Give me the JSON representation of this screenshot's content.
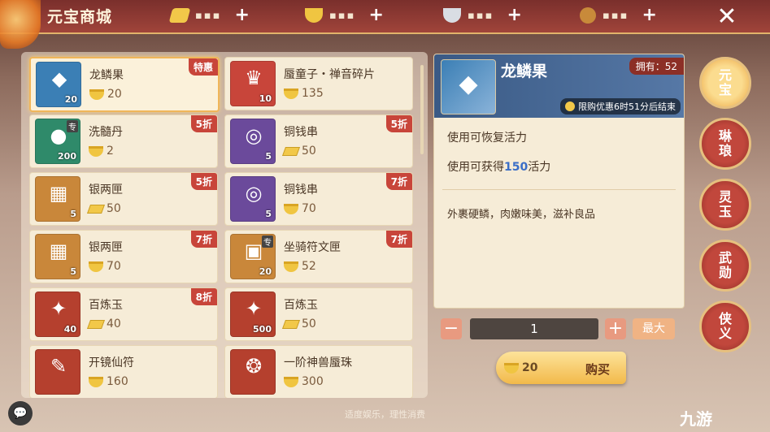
{
  "header": {
    "title": "元宝商城",
    "currencies": [
      {
        "icon": "gold-bar-icon",
        "amount": "▪▪▪",
        "color": "#f2c849"
      },
      {
        "icon": "gold-ingot-icon",
        "amount": "▪▪▪",
        "color": "#f0c541"
      },
      {
        "icon": "silver-ingot-icon",
        "amount": "▪▪▪",
        "color": "#d9dde3"
      },
      {
        "icon": "copper-coin-icon",
        "amount": "▪▪▪",
        "color": "#c88a3a"
      }
    ],
    "plus": "+",
    "close": "✕"
  },
  "items": [
    {
      "name": "龙鳞果",
      "price": "20",
      "qty": "20",
      "badge": "特惠",
      "currency": "ingot",
      "color": "#3b7fb5",
      "glyph": "◆"
    },
    {
      "name": "蜃童子・禅音碎片",
      "price": "135",
      "qty": "10",
      "badge": "",
      "currency": "ingot",
      "color": "#c8453a",
      "glyph": "♛"
    },
    {
      "name": "洗髓丹",
      "price": "2",
      "qty": "200",
      "badge": "5折",
      "currency": "ingot",
      "color": "#2f8a6a",
      "glyph": "●",
      "tag": "专"
    },
    {
      "name": "铜钱串",
      "price": "50",
      "qty": "5",
      "badge": "5折",
      "currency": "bar",
      "color": "#6b4a9b",
      "glyph": "◎"
    },
    {
      "name": "银两匣",
      "price": "50",
      "qty": "5",
      "badge": "5折",
      "currency": "bar",
      "color": "#c9873a",
      "glyph": "▦"
    },
    {
      "name": "铜钱串",
      "price": "70",
      "qty": "5",
      "badge": "7折",
      "currency": "ingot",
      "color": "#6b4a9b",
      "glyph": "◎"
    },
    {
      "name": "银两匣",
      "price": "70",
      "qty": "5",
      "badge": "7折",
      "currency": "ingot",
      "color": "#c9873a",
      "glyph": "▦"
    },
    {
      "name": "坐骑符文匣",
      "price": "52",
      "qty": "20",
      "badge": "7折",
      "currency": "ingot",
      "color": "#c9873a",
      "glyph": "▣",
      "tag": "专"
    },
    {
      "name": "百炼玉",
      "price": "40",
      "qty": "40",
      "badge": "8折",
      "currency": "bar",
      "color": "#b5402e",
      "glyph": "✦"
    },
    {
      "name": "百炼玉",
      "price": "50",
      "qty": "500",
      "badge": "",
      "currency": "bar",
      "color": "#b5402e",
      "glyph": "✦"
    },
    {
      "name": "开镜仙符",
      "price": "160",
      "qty": "",
      "badge": "",
      "currency": "ingot",
      "color": "#b5402e",
      "glyph": "✎"
    },
    {
      "name": "一阶神兽蜃珠",
      "price": "300",
      "qty": "",
      "badge": "",
      "currency": "ingot",
      "color": "#b5402e",
      "glyph": "❂"
    }
  ],
  "detail": {
    "name": "龙鳞果",
    "owned": "拥有：52",
    "timer": "限购优惠6时51分后结束",
    "line1": "使用可恢复活力",
    "line2_pre": "使用可获得",
    "line2_num": "150",
    "line2_post": "活力",
    "desc": "外裹硬鳞，肉嫩味美，滋补良品"
  },
  "quantity": {
    "minus": "−",
    "value": "1",
    "plus": "+",
    "max": "最大"
  },
  "buy": {
    "price": "20",
    "label": "购买"
  },
  "tabs": [
    {
      "label": "元宝",
      "active": true
    },
    {
      "label": "琳琅",
      "active": false
    },
    {
      "label": "灵玉",
      "active": false
    },
    {
      "label": "武勋",
      "active": false
    },
    {
      "label": "侠义",
      "active": false
    }
  ],
  "footer": {
    "note": "适度娱乐，理性消费",
    "chat": "💬",
    "logo": "九游"
  }
}
